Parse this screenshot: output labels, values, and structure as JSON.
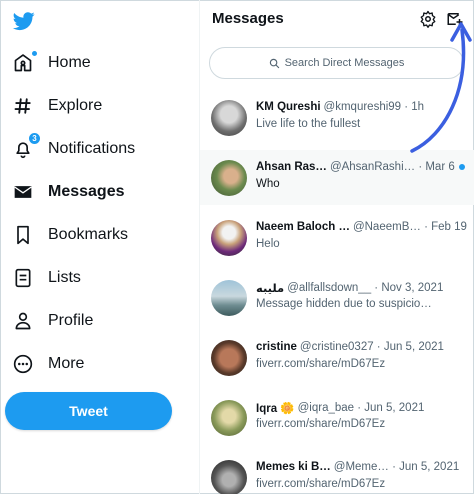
{
  "sidebar": {
    "items": [
      {
        "label": "Home",
        "icon": "home-icon"
      },
      {
        "label": "Explore",
        "icon": "hashtag-icon"
      },
      {
        "label": "Notifications",
        "icon": "bell-icon",
        "badge": "3"
      },
      {
        "label": "Messages",
        "icon": "envelope-icon"
      },
      {
        "label": "Bookmarks",
        "icon": "bookmark-icon"
      },
      {
        "label": "Lists",
        "icon": "list-icon"
      },
      {
        "label": "Profile",
        "icon": "person-icon"
      },
      {
        "label": "More",
        "icon": "more-circle-icon"
      }
    ],
    "tweet_label": "Tweet"
  },
  "messages": {
    "title": "Messages",
    "search_placeholder": "Search Direct Messages",
    "conversations": [
      {
        "name": "KM Qureshi",
        "meta": "@kmqureshi99 · 1h",
        "message": "Live life to the fullest"
      },
      {
        "name": "Ahsan Ras…",
        "meta": "@AhsanRashi… · Mar 6",
        "message": "Who",
        "unread": true
      },
      {
        "name": "Naeem Baloch …",
        "meta": "@NaeemB… · Feb 19",
        "message": "Helo"
      },
      {
        "name": "مليبه",
        "meta": "@allfallsdown__ · Nov 3, 2021",
        "message": "Message hidden due to suspicio…"
      },
      {
        "name": "cristine",
        "meta": "@cristine0327 · Jun 5, 2021",
        "message": "fiverr.com/share/mD67Ez"
      },
      {
        "name": "Iqra 🌼",
        "meta": "@iqra_bae · Jun 5, 2021",
        "message": "fiverr.com/share/mD67Ez"
      },
      {
        "name": "Memes ki B…",
        "meta": "@Meme… · Jun 5, 2021",
        "message": "fiverr.com/share/mD67Ez"
      }
    ]
  },
  "colors": {
    "accent": "#1d9bf0",
    "annotation_arrow": "#3b5fe0"
  }
}
